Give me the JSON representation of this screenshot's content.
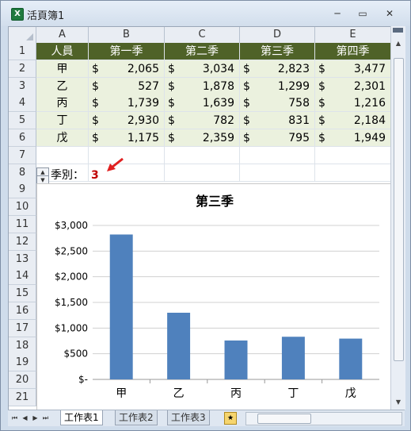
{
  "window": {
    "title": "活頁簿1",
    "minimize_glyph": "─",
    "restore_glyph": "▭",
    "close_glyph": "✕",
    "app_icon_letter": "X"
  },
  "columns": [
    "A",
    "B",
    "C",
    "D",
    "E"
  ],
  "rows": [
    "1",
    "2",
    "3",
    "4",
    "5",
    "6",
    "7",
    "8",
    "9",
    "10",
    "11",
    "12",
    "13",
    "14",
    "15",
    "16",
    "17",
    "18",
    "19",
    "20",
    "21"
  ],
  "table": {
    "headers": [
      "人員",
      "第一季",
      "第二季",
      "第三季",
      "第四季"
    ],
    "currency": "$",
    "records": [
      {
        "name": "甲",
        "q1": "2,065",
        "q2": "3,034",
        "q3": "2,823",
        "q4": "3,477"
      },
      {
        "name": "乙",
        "q1": "527",
        "q2": "1,878",
        "q3": "1,299",
        "q4": "2,301"
      },
      {
        "name": "丙",
        "q1": "1,739",
        "q2": "1,639",
        "q3": "758",
        "q4": "1,216"
      },
      {
        "name": "丁",
        "q1": "2,930",
        "q2": "782",
        "q3": "831",
        "q4": "2,184"
      },
      {
        "name": "戊",
        "q1": "1,175",
        "q2": "2,359",
        "q3": "795",
        "q4": "1,949"
      }
    ]
  },
  "control": {
    "label": "季別：",
    "value": "3",
    "spin_up": "▲",
    "spin_down": "▼"
  },
  "chart_data": {
    "type": "bar",
    "title": "第三季",
    "categories": [
      "甲",
      "乙",
      "丙",
      "丁",
      "戊"
    ],
    "values": [
      2823,
      1299,
      758,
      831,
      795
    ],
    "ylim": [
      0,
      3000
    ],
    "yticks": [
      0,
      500,
      1000,
      1500,
      2000,
      2500,
      3000
    ],
    "ytick_labels": [
      "$-",
      "$500",
      "$1,000",
      "$1,500",
      "$2,000",
      "$2,500",
      "$3,000"
    ],
    "xlabel": "",
    "ylabel": "",
    "grid": true,
    "bar_color": "#4f81bd"
  },
  "sheet_tabs": [
    "工作表1",
    "工作表2",
    "工作表3"
  ],
  "active_tab": 0,
  "nav_glyphs": [
    "⏮",
    "◀",
    "▶",
    "⏭"
  ],
  "scroll_glyphs": {
    "up": "▲",
    "down": "▼",
    "left": "◀",
    "right": "▶"
  },
  "colors": {
    "header_bg": "#4f6228",
    "data_bg": "#ebf1de",
    "highlight_value": "#c00000",
    "arrow": "#e02020"
  }
}
